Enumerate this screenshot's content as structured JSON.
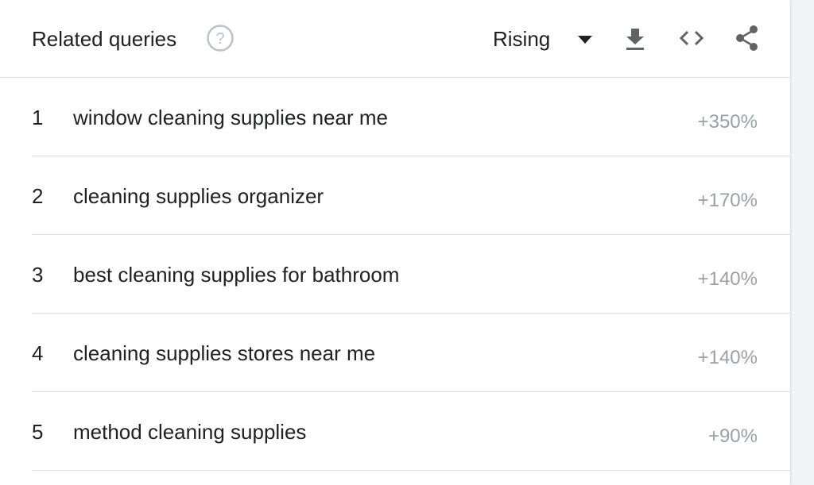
{
  "header": {
    "title": "Related queries",
    "help_icon": "help-circle-icon",
    "selector_value": "Rising",
    "tools": [
      "download-icon",
      "embed-code-icon",
      "share-icon"
    ]
  },
  "queries": [
    {
      "rank": "1",
      "query": "window cleaning supplies near me",
      "value": "+350%"
    },
    {
      "rank": "2",
      "query": "cleaning supplies organizer",
      "value": "+170%"
    },
    {
      "rank": "3",
      "query": "best cleaning supplies for bathroom",
      "value": "+140%"
    },
    {
      "rank": "4",
      "query": "cleaning supplies stores near me",
      "value": "+140%"
    },
    {
      "rank": "5",
      "query": "method cleaning supplies",
      "value": "+90%"
    }
  ],
  "colors": {
    "text": "#202124",
    "muted": "#9aa0a6",
    "icon": "#5f6368",
    "divider": "#dadce0"
  }
}
